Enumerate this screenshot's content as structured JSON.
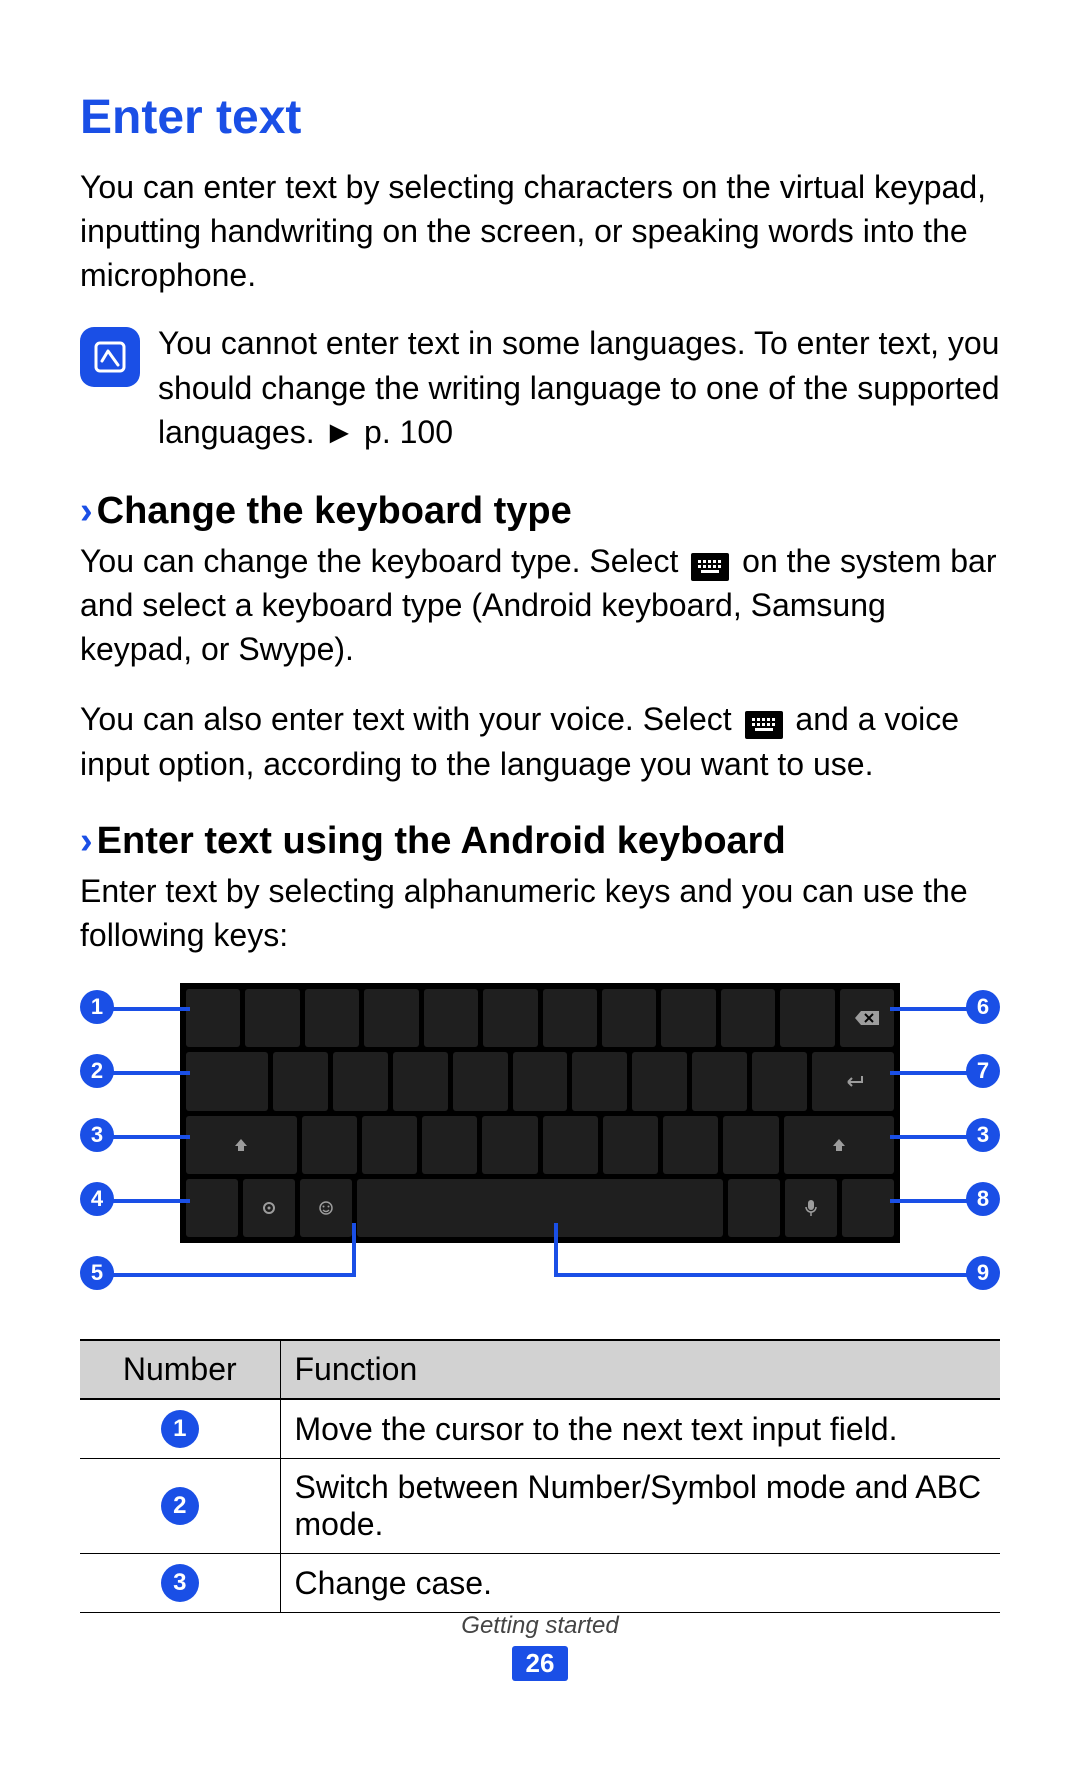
{
  "title": "Enter text",
  "intro": "You can enter text by selecting characters on the virtual keypad, inputting handwriting on the screen, or speaking words into the microphone.",
  "note": "You cannot enter text in some languages. To enter text, you should change the writing language to one of the supported languages. ► p. 100",
  "section1": {
    "heading": "Change the keyboard type",
    "p1a": "You can change the keyboard type. Select ",
    "p1b": " on the system bar and select a keyboard type (Android keyboard, Samsung keypad, or Swype).",
    "p2a": "You can also enter text with your voice. Select ",
    "p2b": " and a voice input option, according to the language you want to use."
  },
  "section2": {
    "heading": "Enter text using the Android keyboard",
    "p1": "Enter text by selecting alphanumeric keys and you can use the following keys:"
  },
  "callouts": [
    "1",
    "2",
    "3",
    "4",
    "5",
    "6",
    "7",
    "3",
    "8",
    "9"
  ],
  "table": {
    "head": {
      "c1": "Number",
      "c2": "Function"
    },
    "rows": [
      {
        "num": "1",
        "fn": "Move the cursor to the next text input field."
      },
      {
        "num": "2",
        "fn": "Switch between Number/Symbol mode and ABC mode."
      },
      {
        "num": "3",
        "fn": "Change case."
      }
    ]
  },
  "footer": {
    "chapter": "Getting started",
    "page": "26"
  },
  "chevron": "›"
}
